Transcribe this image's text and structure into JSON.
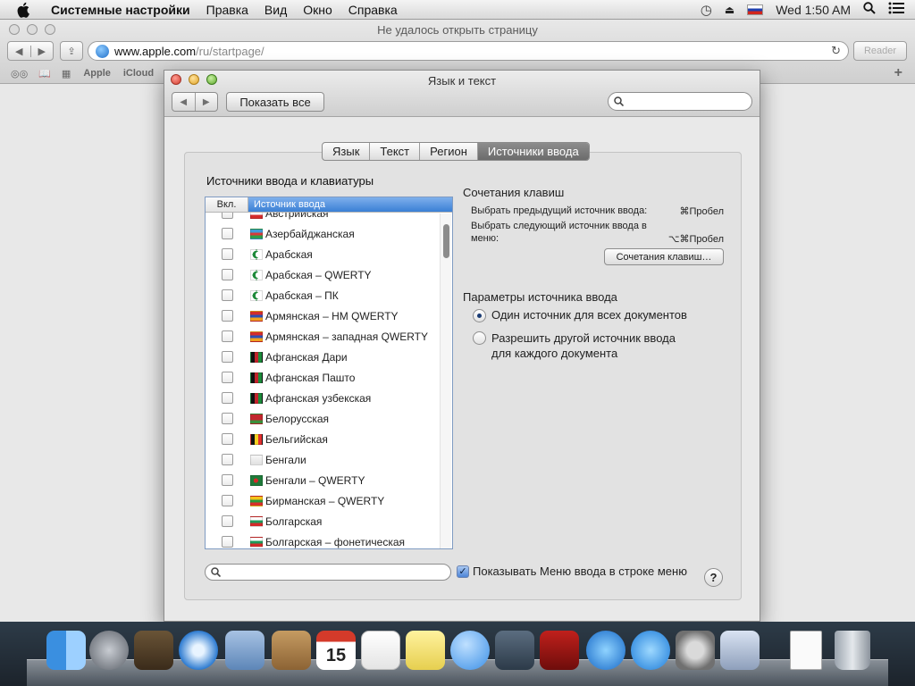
{
  "menubar": {
    "app_name": "Системные настройки",
    "items": [
      "Правка",
      "Вид",
      "Окно",
      "Справка"
    ],
    "clock": "Wed 1:50 AM"
  },
  "browser": {
    "title": "Не удалось открыть страницу",
    "url_host": "www.apple.com",
    "url_path": "/ru/startpage/",
    "reader_label": "Reader",
    "bookmarks": [
      "Apple",
      "iCloud"
    ]
  },
  "prefs": {
    "window_title": "Язык и текст",
    "show_all": "Показать все",
    "tabs": [
      "Язык",
      "Текст",
      "Регион",
      "Источники ввода"
    ],
    "active_tab": "Источники ввода",
    "list_title": "Источники ввода и клавиатуры",
    "col_on": "Вкл.",
    "col_source": "Источник ввода",
    "sources": [
      {
        "name": "Австрийская",
        "icon": "flag-austria-icon"
      },
      {
        "name": "Азербайджанская",
        "icon": "flag-azerbaijan-icon"
      },
      {
        "name": "Арабская",
        "icon": "crescent-icon"
      },
      {
        "name": "Арабская – QWERTY",
        "icon": "crescent-icon"
      },
      {
        "name": "Арабская – ПК",
        "icon": "crescent-pc-icon"
      },
      {
        "name": "Армянская – НМ QWERTY",
        "icon": "flag-armenia-icon"
      },
      {
        "name": "Армянская – западная QWERTY",
        "icon": "flag-armenia-icon"
      },
      {
        "name": "Афганская Дари",
        "icon": "flag-afghanistan-icon"
      },
      {
        "name": "Афганская Пашто",
        "icon": "flag-afghanistan-icon"
      },
      {
        "name": "Афганская узбекская",
        "icon": "flag-afghanistan-icon"
      },
      {
        "name": "Белорусская",
        "icon": "flag-belarus-icon"
      },
      {
        "name": "Бельгийская",
        "icon": "flag-belgium-icon"
      },
      {
        "name": "Бенгали",
        "icon": "bengali-icon"
      },
      {
        "name": "Бенгали – QWERTY",
        "icon": "flag-bangladesh-icon"
      },
      {
        "name": "Бирманская – QWERTY",
        "icon": "flag-myanmar-icon"
      },
      {
        "name": "Болгарская",
        "icon": "flag-bulgaria-icon"
      },
      {
        "name": "Болгарская – фонетическая",
        "icon": "flag-bulgaria-icon"
      }
    ],
    "shortcuts_title": "Сочетания клавиш",
    "shortcut_prev_label": "Выбрать предыдущий источник ввода:",
    "shortcut_prev_key": "⌘Пробел",
    "shortcut_next_label_1": "Выбрать следующий источник ввода в",
    "shortcut_next_label_2": "меню:",
    "shortcut_next_key": "⌥⌘Пробел",
    "shortcuts_button": "Сочетания клавиш…",
    "params_title": "Параметры источника ввода",
    "radio_one": "Один источник для всех документов",
    "radio_each_1": "Разрешить другой источник ввода",
    "radio_each_2": "для каждого документа",
    "selected_radio": "radio_one",
    "show_menu_label": "Показывать Меню ввода в строке меню",
    "show_menu_checked": true,
    "help": "?"
  },
  "dock": {
    "items": [
      "finder-icon",
      "launchpad-icon",
      "mission-control-icon",
      "safari-icon",
      "mail-icon",
      "contacts-icon",
      "calendar-icon",
      "reminders-icon",
      "notes-icon",
      "messages-icon",
      "facetime-icon",
      "photo-booth-icon",
      "itunes-icon",
      "app-store-icon",
      "system-preferences-icon",
      "wizard-icon",
      "preview-document-icon",
      "trash-icon"
    ],
    "calendar_day": "15"
  }
}
